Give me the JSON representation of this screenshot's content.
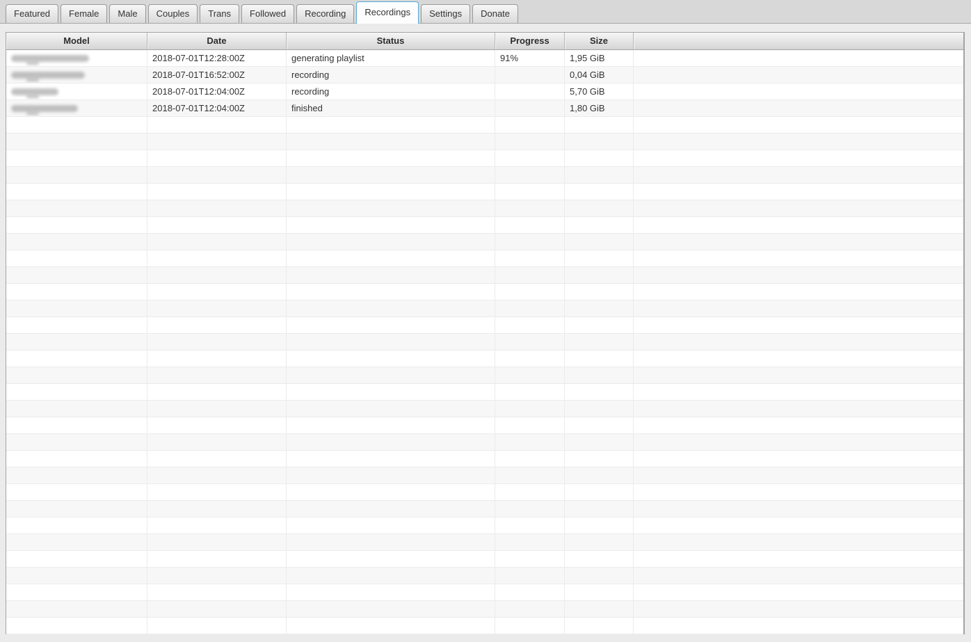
{
  "tab_bar": {
    "tabs": [
      {
        "label": "Featured",
        "active": false
      },
      {
        "label": "Female",
        "active": false
      },
      {
        "label": "Male",
        "active": false
      },
      {
        "label": "Couples",
        "active": false
      },
      {
        "label": "Trans",
        "active": false
      },
      {
        "label": "Followed",
        "active": false
      },
      {
        "label": "Recording",
        "active": false
      },
      {
        "label": "Recordings",
        "active": true
      },
      {
        "label": "Settings",
        "active": false
      },
      {
        "label": "Donate",
        "active": false
      }
    ]
  },
  "colors": {
    "active_tab_border": "#57aad9",
    "tab_strip_bg": "#d8d8d8",
    "page_bg": "#ebebeb",
    "table_border": "#a3a3a3",
    "row_alt_bg": "#f7f7f7",
    "header_text": "#2d2d2d",
    "cell_text": "#333333"
  },
  "table": {
    "columns": [
      {
        "label": "Model"
      },
      {
        "label": "Date"
      },
      {
        "label": "Status"
      },
      {
        "label": "Progress"
      },
      {
        "label": "Size"
      },
      {
        "label": ""
      }
    ],
    "rows": [
      {
        "model_redacted": true,
        "model_blur_width": 112,
        "date": "2018-07-01T12:28:00Z",
        "status": "generating playlist",
        "progress": "91%",
        "size": "1,95 GiB"
      },
      {
        "model_redacted": true,
        "model_blur_width": 106,
        "date": "2018-07-01T16:52:00Z",
        "status": "recording",
        "progress": "",
        "size": "0,04 GiB"
      },
      {
        "model_redacted": true,
        "model_blur_width": 68,
        "date": "2018-07-01T12:04:00Z",
        "status": "recording",
        "progress": "",
        "size": "5,70 GiB"
      },
      {
        "model_redacted": true,
        "model_blur_width": 96,
        "date": "2018-07-01T12:04:00Z",
        "status": "finished",
        "progress": "",
        "size": "1,80 GiB"
      }
    ],
    "empty_row_count": 31
  }
}
